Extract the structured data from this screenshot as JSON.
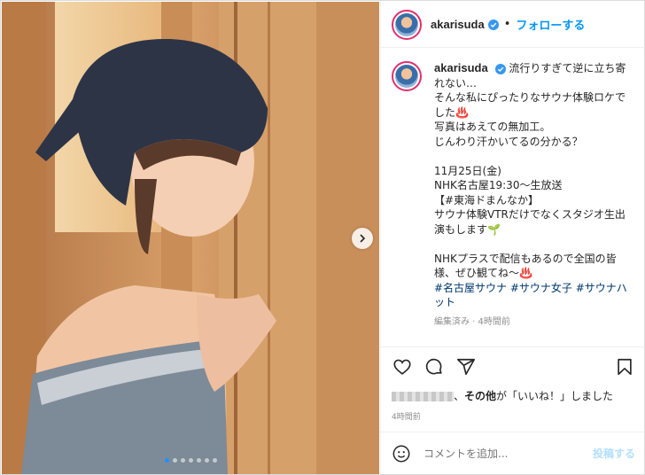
{
  "header": {
    "username": "akarisuda",
    "separator": "•",
    "follow_label": "フォローする"
  },
  "caption": {
    "username": "akarisuda",
    "text": "流行りすぎて逆に立ち寄れない…\nそんな私にぴったりなサウナ体験ロケでした♨️\n写真はあえての無加工。\nじんわり汗かいてるの分かる？\n\n11月25日(金)\nNHK名古屋19:30〜生放送\n【#東海ドまんなか】\nサウナ体験VTRだけでなくスタジオ生出演もします🌱\n\nNHKプラスで配信もあるので全国の皆様、ぜひ観てね〜♨️",
    "hashtags": "#名古屋サウナ #サウナ女子 #サウナハット",
    "meta": "編集済み · 4時間前"
  },
  "likes": {
    "bold": "その他",
    "suffix": "が「いいね！」しました"
  },
  "timestamp": "4時間前",
  "comment": {
    "placeholder": "コメントを追加...",
    "post_label": "投稿する"
  },
  "icons": {
    "next": "chevron-right-icon",
    "like": "heart-icon",
    "comment": "comment-icon",
    "share": "paper-plane-icon",
    "save": "bookmark-icon",
    "emoji": "smiley-icon",
    "verified": "verified-badge-icon"
  },
  "colors": {
    "accent": "#0095f6",
    "hashtag": "#00376b",
    "muted": "#8e8e8e",
    "post_disabled": "#b2dffc"
  },
  "carousel": {
    "slide_count": 7,
    "active_index": 0
  }
}
